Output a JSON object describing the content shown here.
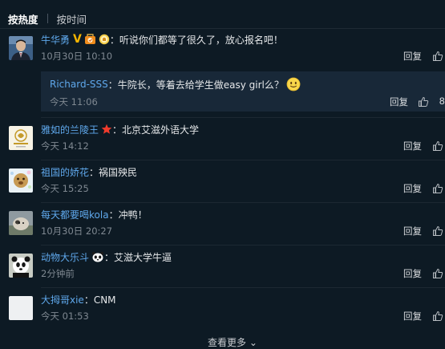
{
  "sort": {
    "active": "按热度",
    "other": "按时间"
  },
  "comments": [
    {
      "user": "牛华勇",
      "text": "：听说你们都等了很久了，放心报名吧！",
      "time": "10月30日 10:10",
      "reply_label": "回复",
      "badges": [
        "v-verified-icon",
        "fan-badge-icon",
        "award-badge-icon"
      ],
      "sub_reply": {
        "user": "Richard-SSS",
        "text": "：牛院长，等着去给学生做easy girl么？",
        "time": "今天 11:06",
        "reply_label": "回复",
        "like_count": "8"
      }
    },
    {
      "user": "雅如的兰陵王",
      "text": "：北京艾滋外语大学",
      "time": "今天 14:12",
      "reply_label": "回复",
      "badges": [
        "red-star-badge-icon"
      ]
    },
    {
      "user": "祖国的娇花",
      "text": "：祸国殃民",
      "time": "今天 15:25",
      "reply_label": "回复"
    },
    {
      "user": "每天都要喝kola",
      "text": "：冲鸭！",
      "time": "10月30日 20:27",
      "reply_label": "回复"
    },
    {
      "user": "动物大乐斗",
      "text": "：艾滋大学牛逼",
      "time": "2分钟前",
      "reply_label": "回复",
      "badges": [
        "panda-emoji-icon"
      ]
    },
    {
      "user": "大拇哥xie",
      "text": "：CNM",
      "time": "今天 01:53",
      "reply_label": "回复"
    }
  ],
  "more_label": "查看更多 ⌄",
  "colors": {
    "background": "#0d1a24",
    "username": "#5fa8ec",
    "meta": "#7f8891",
    "reply_box": "#182838"
  }
}
